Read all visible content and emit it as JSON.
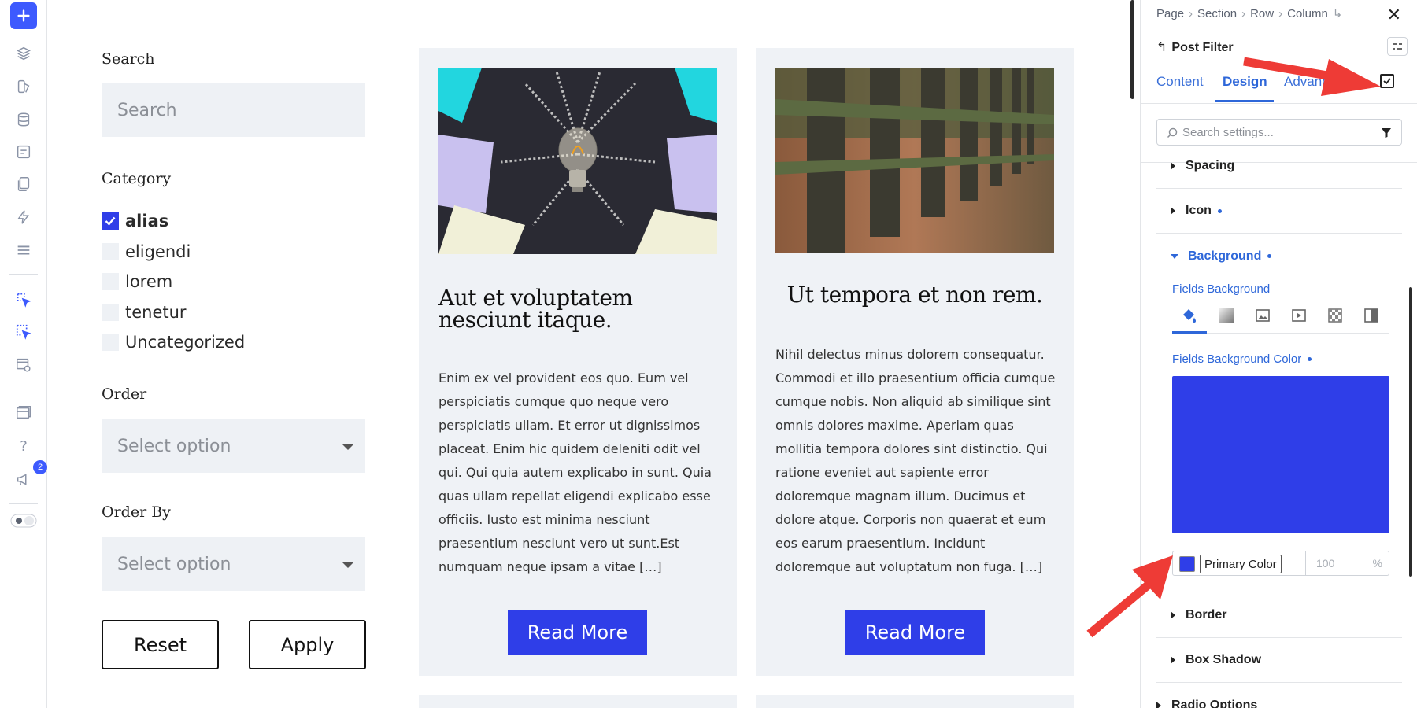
{
  "toolbar": {
    "items": [
      "add-icon",
      "layers-icon",
      "brush-icon",
      "database-icon",
      "form-icon",
      "pages-icon",
      "bolt-icon",
      "list-icon",
      "select-cursor-icon",
      "multi-select-icon",
      "preview-icon",
      "templates-icon",
      "help-icon",
      "megaphone-icon",
      "toggle-icon"
    ],
    "notification_count": "2"
  },
  "filter": {
    "search_label": "Search",
    "search_placeholder": "Search",
    "category_label": "Category",
    "categories": [
      {
        "name": "alias",
        "checked": true
      },
      {
        "name": "eligendi",
        "checked": false
      },
      {
        "name": "lorem",
        "checked": false
      },
      {
        "name": "tenetur",
        "checked": false
      },
      {
        "name": "Uncategorized",
        "checked": false
      }
    ],
    "order_label": "Order",
    "order_value": "Select option",
    "order_by_label": "Order By",
    "order_by_value": "Select option",
    "reset_label": "Reset",
    "apply_label": "Apply"
  },
  "posts": [
    {
      "title": "Aut et voluptatem nesciunt itaque.",
      "excerpt": "Enim ex vel provident eos quo. Eum vel perspiciatis cumque quo neque vero perspiciatis ullam. Et error ut dignissimos placeat. Enim hic quidem deleniti odit vel qui. Qui quia autem explicabo in sunt. Quia quas ullam repellat eligendi explicabo esse officiis. Iusto est minima nesciunt praesentium nesciunt vero ut sunt.Est numquam neque ipsam a vitae […]",
      "button": "Read More"
    },
    {
      "title": "Ut tempora et non rem.",
      "excerpt": "Nihil delectus minus dolorem consequatur. Commodi et illo praesentium officia cumque cumque nobis. Non aliquid ab similique sint omnis dolores maxime. Aperiam quas mollitia tempora dolores sint distinctio. Qui ratione eveniet aut sapiente error doloremque magnam illum. Ducimus et dolore atque. Corporis non quaerat et eum eos earum praesentium. Incidunt doloremque aut voluptatum non fuga. […]",
      "button": "Read More"
    }
  ],
  "panel": {
    "breadcrumb": [
      "Page",
      "Section",
      "Row",
      "Column"
    ],
    "element_title": "Post Filter",
    "tabs": [
      "Content",
      "Design",
      "Advanced"
    ],
    "active_tab": "Design",
    "search_placeholder": "Search settings...",
    "sections": {
      "spacing": "Spacing",
      "icon": "Icon",
      "background": "Background",
      "border": "Border",
      "box_shadow": "Box Shadow",
      "radio_options": "Radio Options"
    },
    "fields_background_label": "Fields Background",
    "fields_background_color_label": "Fields Background Color",
    "color_name": "Primary Color",
    "opacity_placeholder": "100",
    "opacity_unit": "%"
  },
  "colors": {
    "accent": "#2f3ee8",
    "primary_color": "#2f3ee8",
    "link_blue": "#2e67d9",
    "field_bg": "#eef1f5",
    "annotation_red": "#ee3b36"
  }
}
